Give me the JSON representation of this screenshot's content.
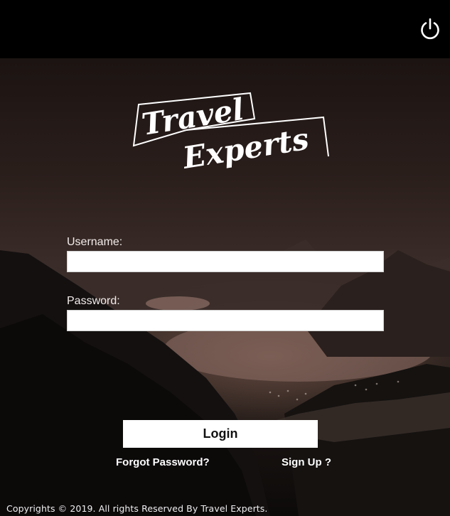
{
  "topbar": {
    "power_icon": "power-icon"
  },
  "logo": {
    "line1": "Travel",
    "line2": "Experts"
  },
  "form": {
    "username_label": "Username:",
    "username_value": "",
    "password_label": "Password:",
    "password_value": "",
    "login_label": "Login"
  },
  "links": {
    "forgot": "Forgot Password?",
    "signup": "Sign Up ?"
  },
  "footer": {
    "text": "Copyrights © 2019. All rights Reserved By Travel Experts."
  },
  "colors": {
    "topbar": "#000000",
    "button_bg": "#ffffff",
    "text_light": "#ffffff"
  }
}
